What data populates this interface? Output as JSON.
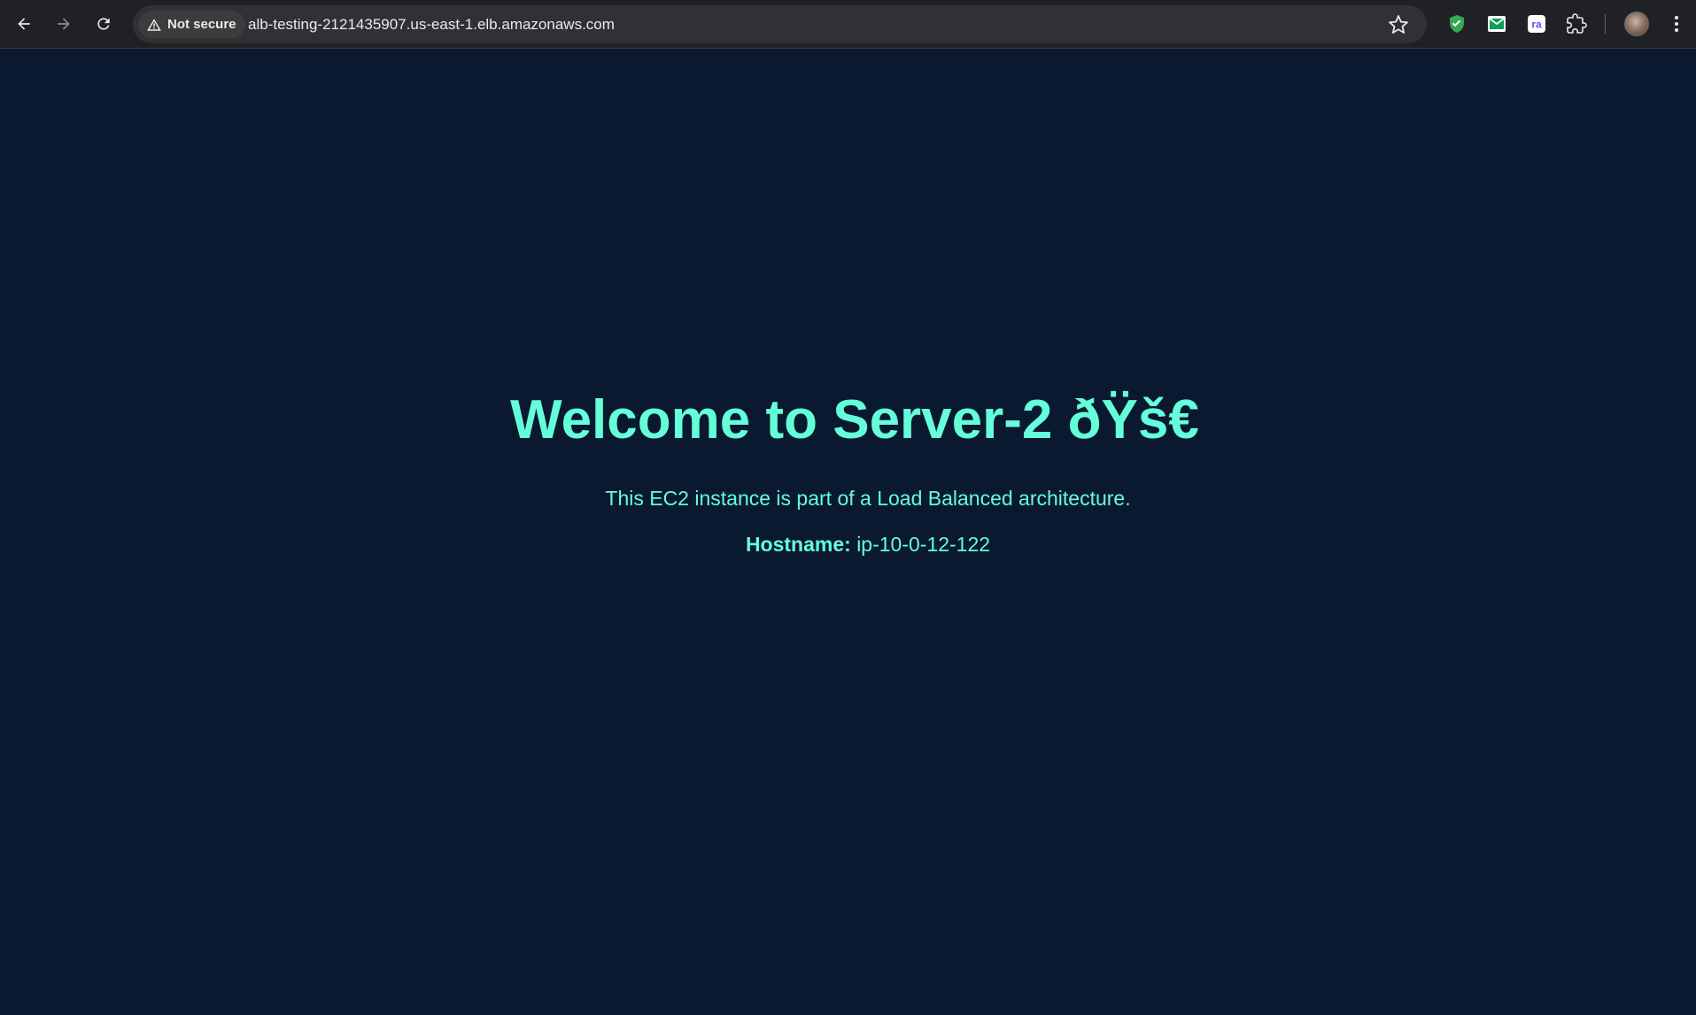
{
  "browser": {
    "security_label": "Not secure",
    "url": "alb-testing-2121435907.us-east-1.elb.amazonaws.com",
    "icons": {
      "back": "back-arrow-icon",
      "forward": "forward-arrow-icon",
      "reload": "reload-icon",
      "warning": "warning-triangle-icon",
      "bookmark": "star-icon",
      "extensions": [
        "shield-check-icon",
        "mail-icon",
        "ra-icon",
        "puzzle-icon"
      ],
      "menu": "vertical-dots-icon"
    },
    "colors": {
      "toolbar": "#202124",
      "omnibox": "#303134"
    }
  },
  "page": {
    "heading": "Welcome to Server-2 ðŸš€",
    "description": "This EC2 instance is part of a Load Balanced architecture.",
    "hostname_label": "Hostname:",
    "hostname_value": "ip-10-0-12-122",
    "colors": {
      "background": "#0b1930",
      "accent": "#64ffda"
    }
  }
}
